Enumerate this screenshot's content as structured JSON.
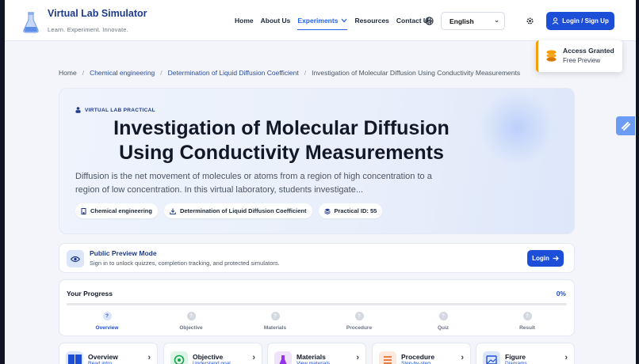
{
  "header": {
    "brand_name": "Virtual Lab Simulator",
    "brand_tagline": "Learn. Experiment. Innovate.",
    "nav": [
      {
        "label": "Home",
        "active": false
      },
      {
        "label": "About Us",
        "active": false
      },
      {
        "label": "Experiments",
        "active": true
      },
      {
        "label": "Resources",
        "active": false
      },
      {
        "label": "Contact Us",
        "active": false
      }
    ],
    "language": "English",
    "login_label": "Login / Sign Up",
    "icons": {
      "globe": "globe-icon",
      "settings": "gear-icon",
      "user": "user-icon"
    }
  },
  "toast": {
    "title": "Access Granted",
    "subtitle": "Free Preview"
  },
  "breadcrumb": [
    {
      "label": "Home"
    },
    {
      "label": "Chemical engineering"
    },
    {
      "label": "Determination of Liquid Diffusion Coefficient"
    },
    {
      "label": "Investigation of Molecular Diffusion Using Conductivity Measurements"
    }
  ],
  "hero": {
    "tag": "VIRTUAL LAB PRACTICAL",
    "title": "Investigation of Molecular Diffusion Using Conductivity Measurements",
    "description": "Diffusion is the net movement of molecules or atoms from a region of high concentration to a region of low concentration. In this virtual laboratory, students investigate...",
    "chips": [
      {
        "label": "Chemical engineering",
        "icon": "building-icon"
      },
      {
        "label": "Determination of Liquid Diffusion Coefficient",
        "icon": "download-icon"
      },
      {
        "label": "Practical ID: 55",
        "icon": "layers-icon"
      }
    ]
  },
  "preview": {
    "title": "Public Preview Mode",
    "subtitle": "Sign in to unlock quizzes, completion tracking, and protected simulators.",
    "button": "Login"
  },
  "progress": {
    "title": "Your Progress",
    "percent_label": "0%",
    "percent": 0,
    "steps": [
      {
        "label": "Overview",
        "symbol": "?",
        "active": true
      },
      {
        "label": "Objective",
        "symbol": "?",
        "active": false
      },
      {
        "label": "Materials",
        "symbol": "?",
        "active": false
      },
      {
        "label": "Procedure",
        "symbol": "?",
        "active": false
      },
      {
        "label": "Quiz",
        "symbol": "?",
        "active": false
      },
      {
        "label": "Result",
        "symbol": "?",
        "active": false
      }
    ]
  },
  "cards": [
    {
      "title": "Overview",
      "subtitle": "Read intro",
      "color": "#dbe6fb",
      "icon": "book-icon"
    },
    {
      "title": "Objective",
      "subtitle": "Understand goal",
      "color": "#dcf5e6",
      "icon": "target-icon"
    },
    {
      "title": "Materials",
      "subtitle": "View materials",
      "color": "#efe3fb",
      "icon": "flask-icon"
    },
    {
      "title": "Procedure",
      "subtitle": "Step-by-step",
      "color": "#fde8dc",
      "icon": "list-icon"
    },
    {
      "title": "Figure",
      "subtitle": "Diagrams",
      "color": "#dbe6fb",
      "icon": "image-icon"
    }
  ]
}
